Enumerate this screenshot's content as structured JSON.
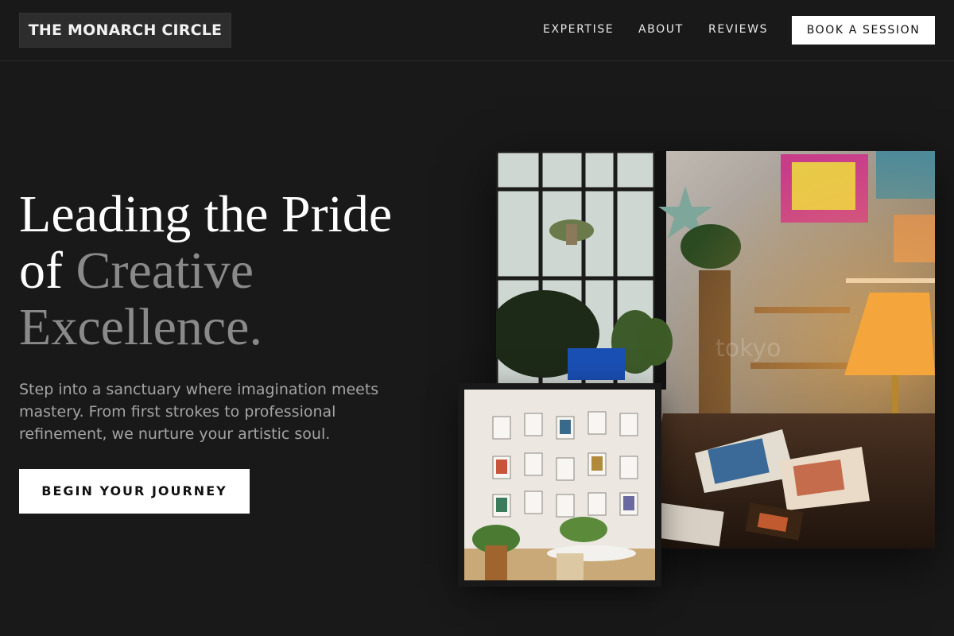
{
  "header": {
    "logo": "THE MONARCH CIRCLE",
    "nav": {
      "expertise": "EXPERTISE",
      "about": "ABOUT",
      "reviews": "REVIEWS"
    },
    "cta": "BOOK A SESSION"
  },
  "hero": {
    "title_line1": "Leading the Pride",
    "title_of": "of ",
    "title_muted1": "Creative",
    "title_muted2": "Excellence.",
    "description": "Step into a sanctuary where imagination meets mastery. From first strokes to professional refinement, we nurture your artistic soul.",
    "cta": "BEGIN YOUR JOURNEY"
  },
  "images": {
    "main_watermark": "tokyo"
  },
  "colors": {
    "background": "#191919",
    "accent": "#ffffff",
    "muted_text": "#8a8a8a"
  }
}
